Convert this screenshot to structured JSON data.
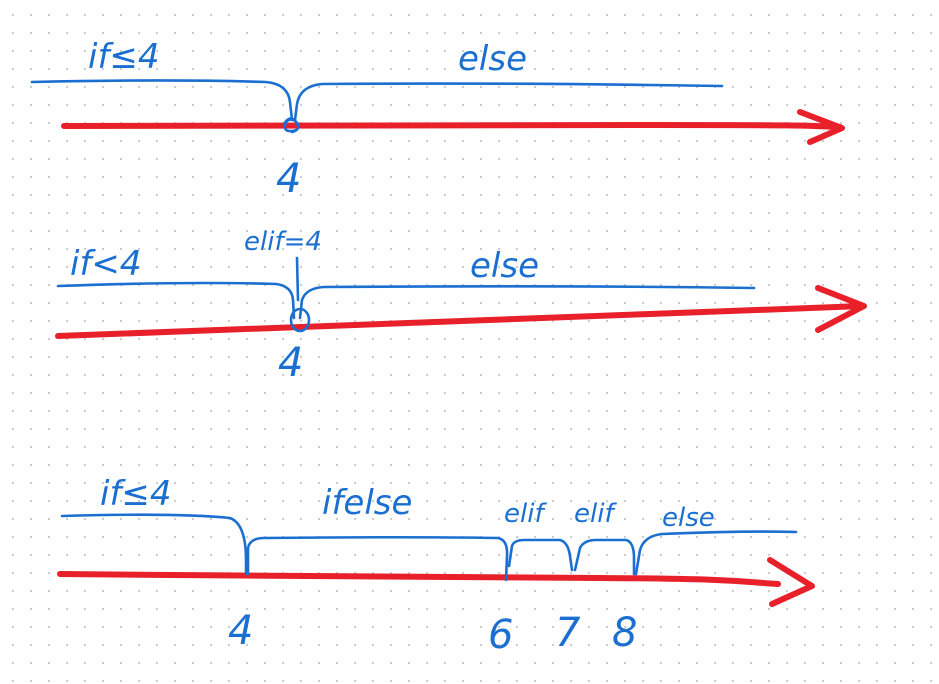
{
  "colors": {
    "axis": "#e8202a",
    "ink": "#1a6fd0",
    "background": "#ffffff",
    "grid_dots": "#c9c9c9"
  },
  "diagrams": [
    {
      "name": "top",
      "labels": {
        "left": "if≤4",
        "right": "else"
      },
      "ticks": [
        "4"
      ]
    },
    {
      "name": "middle",
      "labels": {
        "left": "if<4",
        "middle": "elif=4",
        "right": "else"
      },
      "ticks": [
        "4"
      ]
    },
    {
      "name": "bottom",
      "labels": {
        "first": "if≤4",
        "second": "ifelse",
        "third": "elif",
        "fourth": "elif",
        "fifth": "else"
      },
      "ticks": [
        "4",
        "6",
        "7",
        "8"
      ]
    }
  ]
}
